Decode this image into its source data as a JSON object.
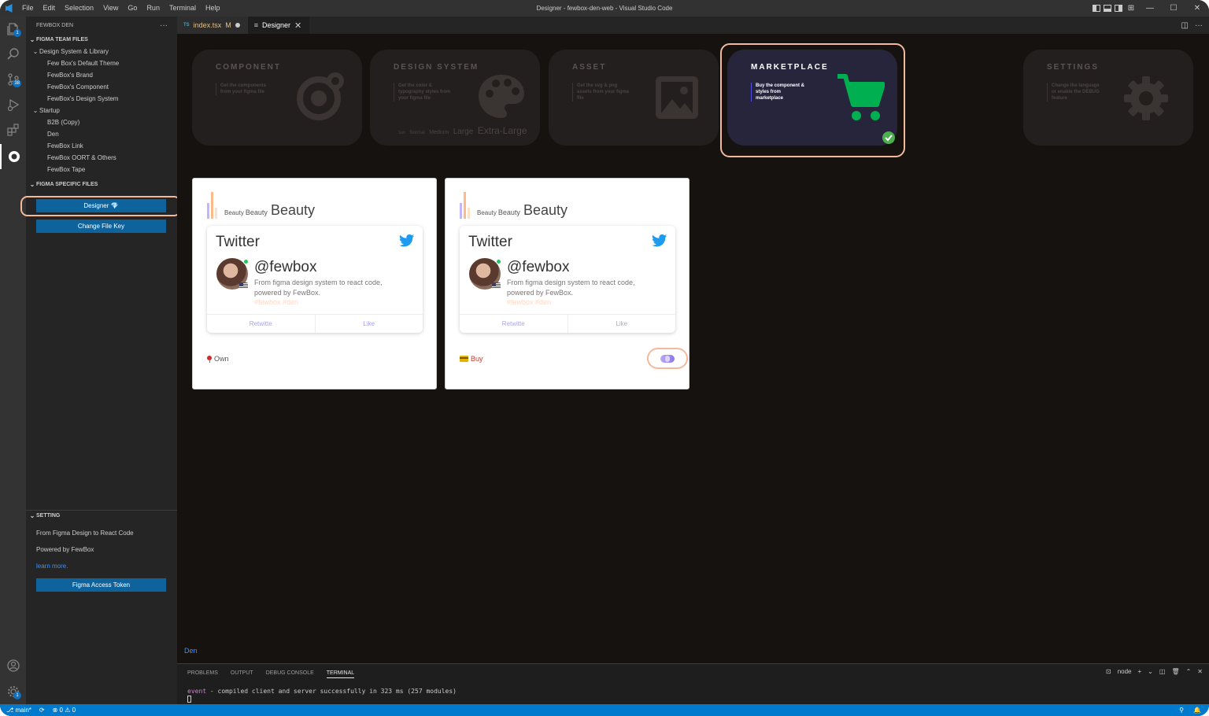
{
  "window": {
    "title": "Designer - fewbox-den-web - Visual Studio Code",
    "menu": [
      "File",
      "Edit",
      "Selection",
      "View",
      "Go",
      "Run",
      "Terminal",
      "Help"
    ]
  },
  "activity_bar": {
    "explorer_badge": "1",
    "source_control_badge": "38",
    "accounts_badge": "1",
    "icons": [
      "files-icon",
      "search-icon",
      "source-control-icon",
      "run-debug-icon",
      "extensions-icon",
      "fewbox-icon",
      "account-icon",
      "settings-gear-icon"
    ]
  },
  "sidebar": {
    "title": "FEWBOX DEN",
    "more": "···",
    "team_files_title": "FIGMA TEAM FILES",
    "groups": [
      {
        "label": "Design System & Library",
        "items": [
          "Few Box's Default Theme",
          "FewBox's Brand",
          "FewBox's Component",
          "FewBox's Design System"
        ]
      },
      {
        "label": "Startup",
        "items": [
          "B2B (Copy)",
          "Den",
          "FewBox Link",
          "FewBox OORT & Others",
          "FewBox Tape"
        ]
      }
    ],
    "specific_files_title": "FIGMA SPECIFIC FILES",
    "designer_button": "Designer 💎",
    "change_key_button": "Change File Key",
    "setting_title": "SETTING",
    "setting_line1": "From Figma Design to React Code",
    "setting_line2": "Powered by FewBox",
    "learn_more": "learn more.",
    "token_button": "Figma Access Token"
  },
  "tabs": [
    {
      "prefix": "TS",
      "label": "index.tsx",
      "status": "M"
    },
    {
      "prefix": "≡",
      "label": "Designer",
      "close": "✕"
    }
  ],
  "nav_cards": [
    {
      "title": "COMPONENT",
      "desc": "Get the components from your figma file"
    },
    {
      "title": "DESIGN SYSTEM",
      "desc": "Get the color & typography styles from your figma file",
      "scale": [
        "Sub",
        "Normal",
        "Medium",
        "Large",
        "Extra-Large"
      ]
    },
    {
      "title": "ASSET",
      "desc": "Get the svg & png assets from your figma file"
    },
    {
      "title": "MARKETPLACE",
      "desc": "Buy the component & styles from marketplace"
    },
    {
      "title": "SETTINGS",
      "desc": "Change the language or enable the DEBUG feature"
    }
  ],
  "items": [
    {
      "brand_small": "Beauty",
      "brand_medium": "Beauty",
      "brand_large": "Beauty",
      "network": "Twitter",
      "handle": "@fewbox",
      "description": "From figma design system to react code, powered by FewBox.",
      "tags": "#fewbox  #den",
      "retweet": "Retwitte",
      "like": "Like",
      "status": "Own"
    },
    {
      "brand_small": "Beauty",
      "brand_medium": "Beauty",
      "brand_large": "Beauty",
      "network": "Twitter",
      "handle": "@fewbox",
      "description": "From figma design system to react code, powered by FewBox.",
      "tags": "#fewbox  #den",
      "retweet": "Retwitte",
      "like": "Like",
      "status": "Buy"
    }
  ],
  "editor_footer": "Den",
  "panel": {
    "tabs": [
      "PROBLEMS",
      "OUTPUT",
      "DEBUG CONSOLE",
      "TERMINAL"
    ],
    "terminal_name": "node",
    "event_word": "event",
    "event_text": " - compiled client and server successfully in 323 ms (257 modules)"
  },
  "statusbar": {
    "branch": "main*",
    "errors": "0",
    "warnings": "0"
  },
  "colors": {
    "accent": "#007acc",
    "button": "#0e639c",
    "highlight": "#f4b99a",
    "marketplace_bg": "#26253c",
    "cart_green": "#00b050"
  }
}
